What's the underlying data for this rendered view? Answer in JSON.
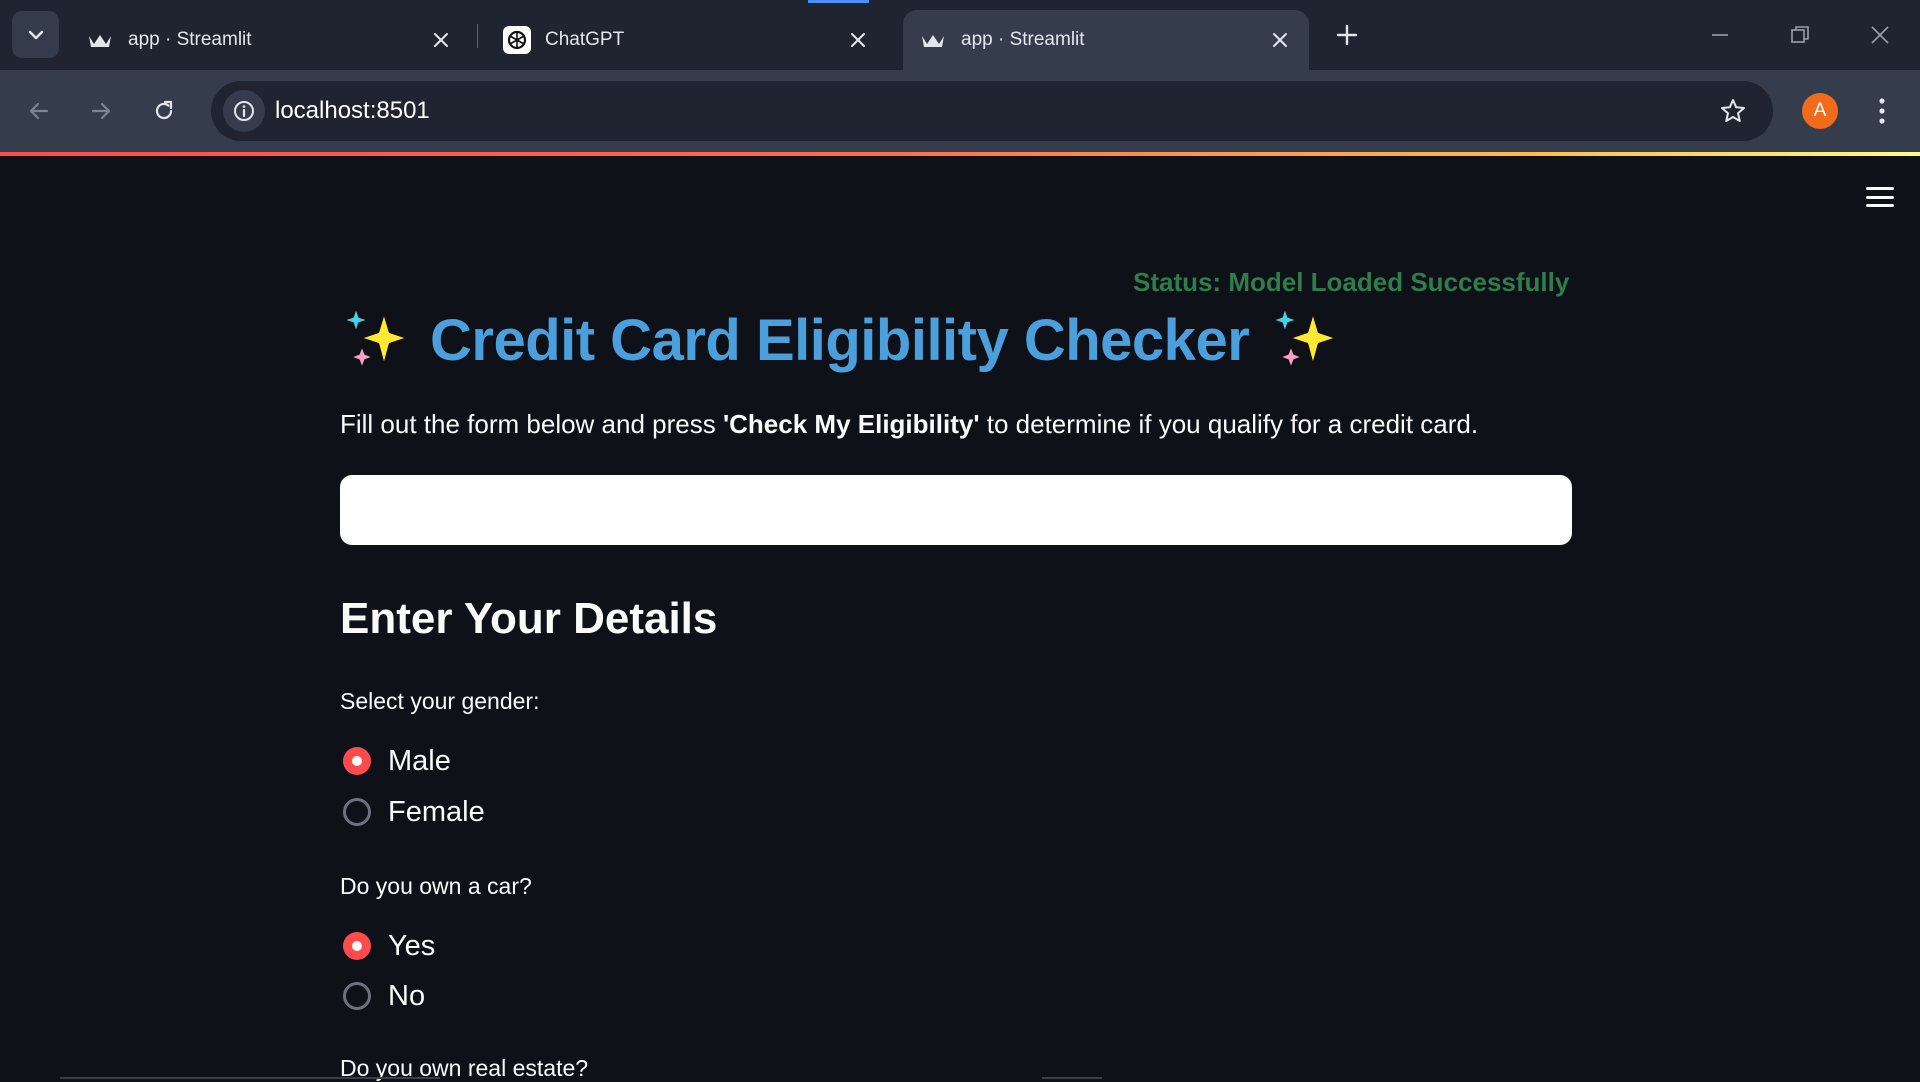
{
  "browser": {
    "tabs": [
      {
        "title": "app · Streamlit",
        "icon": "streamlit-crown-icon",
        "active": false
      },
      {
        "title": "ChatGPT",
        "icon": "chatgpt-logo-icon",
        "active": false
      },
      {
        "title": "app · Streamlit",
        "icon": "streamlit-crown-icon",
        "active": true
      }
    ],
    "url": "localhost:8501",
    "profile_initial": "A",
    "colors": {
      "tabstrip": "#1f2430",
      "toolbar": "#353c4c",
      "avatar": "#f26b1d"
    }
  },
  "app": {
    "status": "Status: Model Loaded Successfully",
    "title": "Credit Card Eligibility Checker",
    "title_emoji": "sparkles-icon",
    "intro": {
      "before": "Fill out the form below and press ",
      "bold": "'Check My Eligibility'",
      "after": " to determine if you qualify for a credit card."
    },
    "section_title": "Enter Your Details",
    "questions": [
      {
        "label": "Select your gender:",
        "options": [
          "Male",
          "Female"
        ],
        "selected": "Male"
      },
      {
        "label": "Do you own a car?",
        "options": [
          "Yes",
          "No"
        ],
        "selected": "Yes"
      },
      {
        "label": "Do you own real estate?"
      }
    ],
    "colors": {
      "background": "#0e1117",
      "title": "#4a9fdc",
      "status": "#2e7d4a",
      "radio_checked": "#ff4b4b"
    }
  }
}
